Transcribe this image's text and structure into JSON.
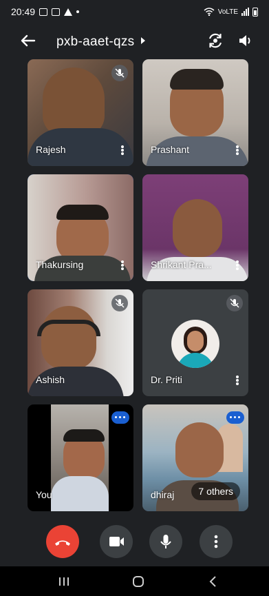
{
  "status_bar": {
    "time": "20:49",
    "network": "VoLTE"
  },
  "header": {
    "meeting_code": "pxb-aaet-qzs"
  },
  "participants": [
    {
      "name": "Rajesh"
    },
    {
      "name": "Prashant"
    },
    {
      "name": "Thakursing"
    },
    {
      "name": "Shrikant Pra..."
    },
    {
      "name": "Ashish"
    },
    {
      "name": "Dr. Priti"
    },
    {
      "name": "You"
    },
    {
      "name": "dhiraj"
    }
  ],
  "others_label": "7 others",
  "colors": {
    "end_call": "#ea4335",
    "active_border": "#1a5fd1",
    "tile_bg": "#3c4043"
  }
}
